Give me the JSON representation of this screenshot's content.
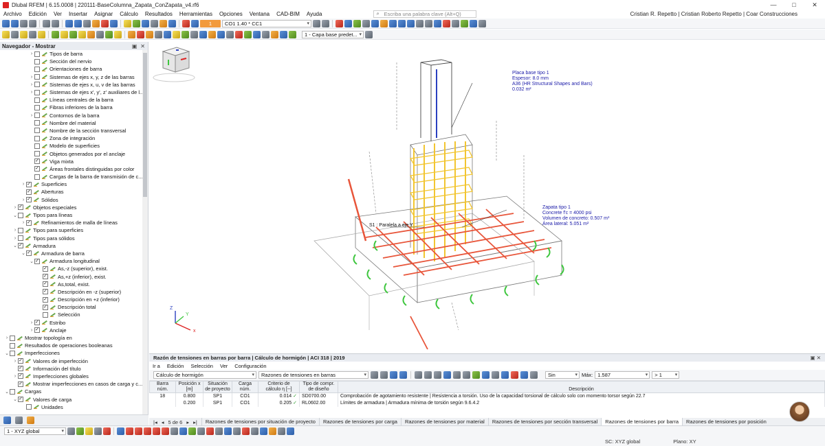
{
  "window": {
    "title": "Dlubal RFEM | 6.15.0008 | 220111-BaseColumna_Zapata_ConZapata_v4.rf6",
    "controls": [
      "—",
      "□",
      "✕"
    ]
  },
  "menu": {
    "items": [
      "Archivo",
      "Edición",
      "Ver",
      "Insertar",
      "Asignar",
      "Cálculo",
      "Resultados",
      "Herramientas",
      "Opciones",
      "Ventana",
      "CAD-BIM",
      "Ayuda"
    ],
    "search_placeholder": "Escriba una palabra clave (Alt+Q)",
    "user": "Cristian R. Repetto | Cristian Roberto Repetto | Coar Construcciones"
  },
  "toolbar": {
    "load_case_badge": "1",
    "load_combo": "CO1    1.40 * CC1",
    "layer": "1 - Capa base predet..."
  },
  "navigator": {
    "title": "Navegador - Mostrar",
    "items": [
      {
        "level": 4,
        "arrow": "›",
        "check": false,
        "icon": true,
        "label": "Tipos de barra"
      },
      {
        "level": 4,
        "arrow": "",
        "check": false,
        "icon": true,
        "label": "Sección del nervio"
      },
      {
        "level": 4,
        "arrow": "",
        "check": false,
        "icon": true,
        "label": "Orientaciones de barra"
      },
      {
        "level": 4,
        "arrow": "›",
        "check": false,
        "icon": true,
        "label": "Sistemas de ejes x, y, z de las barras"
      },
      {
        "level": 4,
        "arrow": "›",
        "check": false,
        "icon": true,
        "label": "Sistemas de ejes x, u, v de las barras"
      },
      {
        "level": 4,
        "arrow": "›",
        "check": false,
        "icon": true,
        "label": "Sistemas de ejes x', y', z' auxiliares de l..."
      },
      {
        "level": 4,
        "arrow": "",
        "check": false,
        "icon": true,
        "label": "Líneas centrales de la barra"
      },
      {
        "level": 4,
        "arrow": "",
        "check": false,
        "icon": true,
        "label": "Fibras inferiores de la barra"
      },
      {
        "level": 4,
        "arrow": "›",
        "check": false,
        "icon": true,
        "label": "Contornos de la barra"
      },
      {
        "level": 4,
        "arrow": "",
        "check": false,
        "icon": true,
        "label": "Nombre del material"
      },
      {
        "level": 4,
        "arrow": "",
        "check": false,
        "icon": true,
        "label": "Nombre de la sección transversal"
      },
      {
        "level": 4,
        "arrow": "",
        "check": false,
        "icon": true,
        "label": "Zona de integración"
      },
      {
        "level": 4,
        "arrow": "",
        "check": false,
        "icon": true,
        "label": "Modelo de superficies"
      },
      {
        "level": 4,
        "arrow": "",
        "check": false,
        "icon": true,
        "label": "Objetos generados por el anclaje"
      },
      {
        "level": 4,
        "arrow": "",
        "check": true,
        "icon": true,
        "label": "Viga mixta"
      },
      {
        "level": 4,
        "arrow": "",
        "check": true,
        "icon": true,
        "label": "Áreas frontales distinguidas por color"
      },
      {
        "level": 4,
        "arrow": "",
        "check": false,
        "icon": true,
        "label": "Cargas de la barra de transmisión de c..."
      },
      {
        "level": 3,
        "arrow": "›",
        "check": true,
        "icon": true,
        "label": "Superficies"
      },
      {
        "level": 3,
        "arrow": "",
        "check": true,
        "icon": true,
        "label": "Aberturas"
      },
      {
        "level": 3,
        "arrow": "›",
        "check": true,
        "icon": true,
        "label": "Sólidos"
      },
      {
        "level": 2,
        "arrow": "›",
        "check": true,
        "icon": true,
        "label": "Objetos especiales"
      },
      {
        "level": 2,
        "arrow": "⌄",
        "check": false,
        "icon": true,
        "label": "Tipos para líneas"
      },
      {
        "level": 3,
        "arrow": "›",
        "check": true,
        "icon": true,
        "label": "Refinamientos de malla de líneas"
      },
      {
        "level": 2,
        "arrow": "›",
        "check": false,
        "icon": true,
        "label": "Tipos para superficies"
      },
      {
        "level": 2,
        "arrow": "›",
        "check": false,
        "icon": true,
        "label": "Tipos para sólidos"
      },
      {
        "level": 2,
        "arrow": "⌄",
        "check": true,
        "icon": true,
        "label": "Armadura"
      },
      {
        "level": 3,
        "arrow": "⌄",
        "check": true,
        "icon": true,
        "label": "Armadura de barra"
      },
      {
        "level": 4,
        "arrow": "⌄",
        "check": true,
        "icon": true,
        "label": "Armadura longitudinal"
      },
      {
        "level": 5,
        "arrow": "",
        "check": true,
        "icon": true,
        "label": "As,-z (superior), exist."
      },
      {
        "level": 5,
        "arrow": "",
        "check": true,
        "icon": true,
        "label": "As,+z (inferior), exist."
      },
      {
        "level": 5,
        "arrow": "",
        "check": true,
        "icon": true,
        "label": "As,total, exist."
      },
      {
        "level": 5,
        "arrow": "",
        "check": true,
        "icon": true,
        "label": "Descripción en -z (superior)"
      },
      {
        "level": 5,
        "arrow": "",
        "check": true,
        "icon": true,
        "label": "Descripción en +z (inferior)"
      },
      {
        "level": 5,
        "arrow": "",
        "check": true,
        "icon": true,
        "label": "Descripción total"
      },
      {
        "level": 5,
        "arrow": "",
        "check": false,
        "icon": true,
        "label": "Selección"
      },
      {
        "level": 4,
        "arrow": "›",
        "check": true,
        "icon": true,
        "label": "Estribo"
      },
      {
        "level": 4,
        "arrow": "›",
        "check": true,
        "icon": true,
        "label": "Anclaje"
      },
      {
        "level": 1,
        "arrow": "›",
        "check": false,
        "icon": true,
        "label": "Mostrar topología en"
      },
      {
        "level": 1,
        "arrow": "",
        "check": false,
        "icon": true,
        "label": "Resultados de operaciones booleanas"
      },
      {
        "level": 1,
        "arrow": "⌄",
        "check": false,
        "icon": true,
        "label": "Imperfecciones"
      },
      {
        "level": 2,
        "arrow": "›",
        "check": true,
        "icon": true,
        "label": "Valores de imperfección"
      },
      {
        "level": 2,
        "arrow": "",
        "check": true,
        "icon": true,
        "label": "Información del título"
      },
      {
        "level": 2,
        "arrow": "›",
        "check": true,
        "icon": true,
        "label": "Imperfecciones globales"
      },
      {
        "level": 2,
        "arrow": "",
        "check": true,
        "icon": true,
        "label": "Mostrar imperfecciones en casos de carga y c..."
      },
      {
        "level": 1,
        "arrow": "⌄",
        "check": false,
        "icon": true,
        "label": "Cargas"
      },
      {
        "level": 2,
        "arrow": "⌄",
        "check": true,
        "icon": true,
        "label": "Valores de carga"
      },
      {
        "level": 3,
        "arrow": "",
        "check": false,
        "icon": true,
        "label": "Unidades"
      }
    ]
  },
  "viewport": {
    "annot_placa": [
      "Placa base tipo 1",
      "Espesor: 8.0 mm",
      "A36 (HR Structural Shapes and Bars)",
      "0.032 m²"
    ],
    "annot_zapata": [
      "Zapata tipo 1",
      "Concrete f'c = 4000 psi",
      "Volumen de concreto: 0.507 m³",
      "Área lateral: 5.051 m²"
    ],
    "annot_s1": "S1 : Paralela a eje Y",
    "axis_labels": {
      "z": "Z",
      "y": "Y",
      "x": "x"
    }
  },
  "results": {
    "title": "Razón de tensiones en barras por barra | Cálculo de hormigón | ACI 318 | 2019",
    "menu": [
      "Ir a",
      "Edición",
      "Selección",
      "Ver",
      "Configuración"
    ],
    "module_combo": "Cálculo de hormigón",
    "result_combo": "Razones de tensiones en barras",
    "filter_combo": "Sin",
    "max_label": "Máx:",
    "max_value": "1.587",
    "gt_label": "> 1",
    "columns": [
      "Barra núm.",
      "Posición x [m]",
      "Situación de proyecto",
      "Carga núm.",
      "Criterio de cálculo η [--]",
      "Tipo de compr. de diseño",
      "Descripción"
    ],
    "rows": [
      {
        "barra": "18",
        "pos": "0.800",
        "sit": "SP1",
        "carga": "CO1",
        "crit": "0.014",
        "tipo": "SD0700.00",
        "desc": "Comprobación de agotamiento resistente | Resistencia a torsión. Uso de la capacidad torsional de cálculo solo con momento torsor según 22.7"
      },
      {
        "barra": "",
        "pos": "0.200",
        "sit": "SP1",
        "carga": "CO1",
        "crit": "0.205",
        "tipo": "RL0602.00",
        "desc": "Límites de armadura | Armadura mínima de torsión según 9.6.4.2"
      }
    ],
    "pager": "5 de 6",
    "tabs": [
      "Razones de tensiones por situación de proyecto",
      "Razones de tensiones por carga",
      "Razones de tensiones por material",
      "Razones de tensiones por sección transversal",
      "Razones de tensiones por barra",
      "Razones de tensiones por posición"
    ],
    "active_tab": 4
  },
  "status": {
    "view_combo": "1 - XYZ global",
    "sc": "SC: XYZ global",
    "plane": "Plano: XY"
  },
  "colors": {
    "accent_orange": "#f29a3c",
    "rebar_red": "#e8553a",
    "rebar_yellow": "#f2c530",
    "anchor_green": "#3ec63e",
    "annot_blue": "#1a1aa8"
  }
}
